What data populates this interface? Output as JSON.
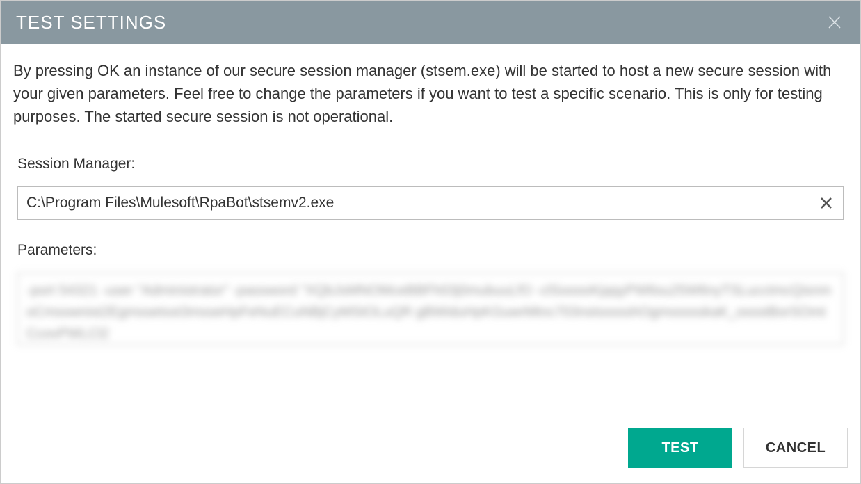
{
  "titlebar": {
    "title": "TEST SETTINGS"
  },
  "description": "By pressing OK an instance of our secure session manager (stsem.exe) will be started to host a new secure session with your given parameters. Feel free to change the parameters if you want to test a specific scenario. This is only for testing purposes. The started secure session is not operational.",
  "form": {
    "session_manager": {
      "label": "Session Manager:",
      "value": "C:\\Program Files\\Mulesoft\\RpaBot\\stsemv2.exe"
    },
    "parameters": {
      "label": "Parameters:",
      "value": "-port 54321 -user \"Administrator\" -password \"XQbJsMNOMceBBFh03j0mubuuLfO -clSooooKjqqyPW6su25W6nyTSLucctmcQisnmoCmsswnist2Egmssetsst3msseHpFeNuECuNBjCyMStOLuQR gBWiduHpKGuwrMtnc703nstssssshOgmssssskaK_ossstBorSOmtCcovPWLCl2"
    }
  },
  "buttons": {
    "test_label": "TEST",
    "cancel_label": "CANCEL"
  }
}
